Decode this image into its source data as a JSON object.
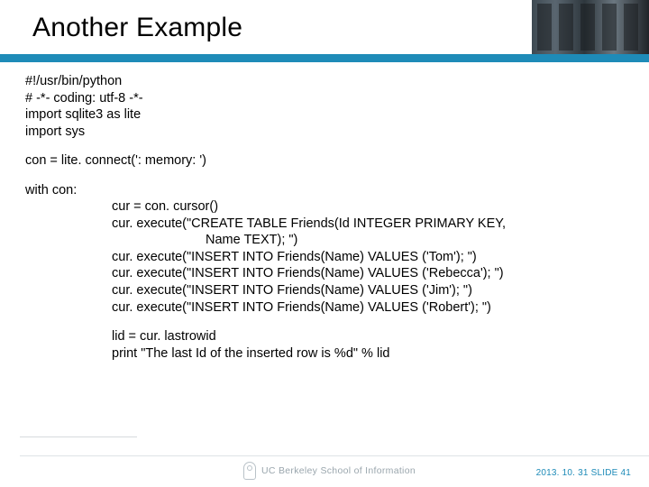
{
  "title": "Another Example",
  "code": {
    "l1": "#!/usr/bin/python",
    "l2": "# -*- coding: utf-8 -*-",
    "l3": "import sqlite3 as lite",
    "l4": "import sys",
    "l5": "con = lite. connect(': memory: ')",
    "l6": "with con:",
    "l7": "cur = con. cursor()",
    "l8": "cur. execute(\"CREATE TABLE Friends(Id INTEGER PRIMARY KEY,",
    "l9": "Name TEXT); \")",
    "l10": "cur. execute(\"INSERT INTO Friends(Name) VALUES ('Tom'); \")",
    "l11": "cur. execute(\"INSERT INTO Friends(Name) VALUES ('Rebecca'); \")",
    "l12": "cur. execute(\"INSERT INTO Friends(Name) VALUES ('Jim'); \")",
    "l13": "cur. execute(\"INSERT INTO Friends(Name) VALUES ('Robert'); \")",
    "l14": "lid = cur. lastrowid",
    "l15": "print \"The last Id of the inserted row is %d\" % lid"
  },
  "footer": {
    "brand": "UC Berkeley School of Information",
    "slide": "2013. 10. 31 SLIDE 41"
  }
}
